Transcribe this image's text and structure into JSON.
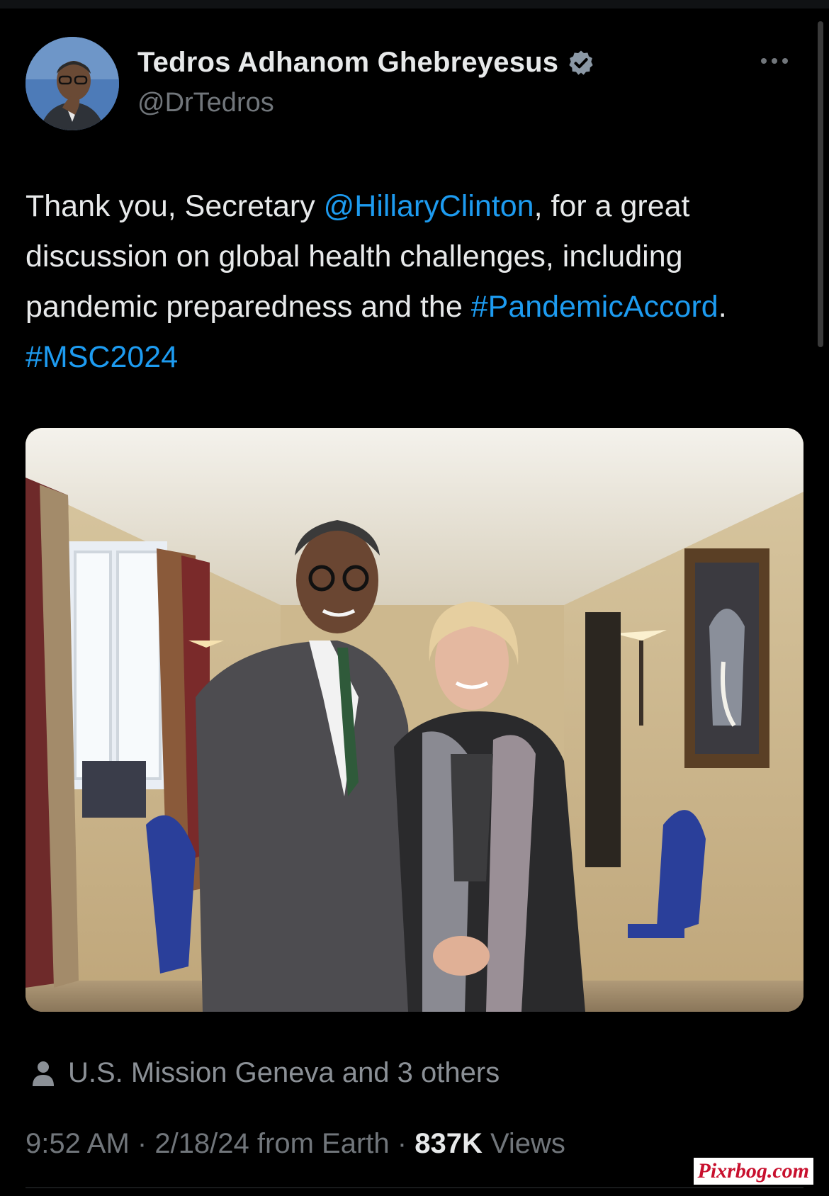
{
  "tweet": {
    "author": {
      "display_name": "Tedros Adhanom Ghebreyesus",
      "handle": "@DrTedros",
      "verified_icon": "verified-badge-icon"
    },
    "text": {
      "p1": "Thank you, Secretary ",
      "mention": "@HillaryClinton",
      "p2": ", for a great discussion on global health challenges, including pandemic preparedness and the ",
      "hashtag1": "#PandemicAccord",
      "p3": ". ",
      "hashtag2": "#MSC2024"
    },
    "tagged": "U.S. Mission Geneva and 3 others",
    "meta": {
      "time": "9:52 AM",
      "date": "2/18/24",
      "source": "from Earth",
      "views_count": "837K",
      "views_label": "Views"
    }
  },
  "watermark": "Pixrbog.com",
  "colors": {
    "background": "#000000",
    "text": "#e7e9ea",
    "secondary": "#71767b",
    "link": "#1d9bf0"
  }
}
